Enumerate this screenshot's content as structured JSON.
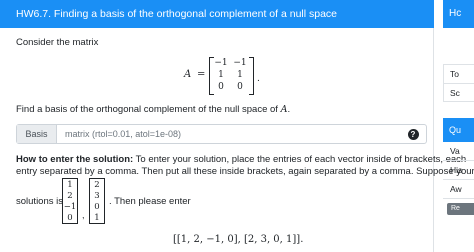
{
  "header": {
    "title": "HW6.7. Finding a basis of the orthogonal complement of a null space"
  },
  "question": {
    "consider": "Consider the matrix",
    "matrix": {
      "label": "A",
      "equals": "=",
      "rows": [
        [
          "−1",
          "−1"
        ],
        [
          "1",
          "1"
        ],
        [
          "0",
          "0"
        ]
      ],
      "period": "."
    },
    "task_prefix": "Find a basis of the orthogonal complement of the null space of ",
    "task_var": "A",
    "task_suffix": "."
  },
  "answer": {
    "addon_label": "Basis",
    "placeholder": "matrix (rtol=0.01, atol=1e-08)",
    "help_symbol": "?"
  },
  "instructions": {
    "heading": "How to enter the solution:",
    "line1_text": " To enter your solution, place the entries of each vector inside of brackets, each",
    "line2_text": "entry separated by a comma. Then put all these inside brackets, again separated by a comma. Suppose your",
    "solutions_is": "solutions is",
    "vector1": [
      "1",
      "2",
      "−1",
      "0"
    ],
    "vector2": [
      "2",
      "3",
      "0",
      "1"
    ],
    "vector_separator": ",",
    "then_enter": ". Then please enter",
    "example": "[[1, 2, −1, 0], [2, 3, 0, 1]]."
  },
  "sidebar": {
    "top_header": "Hc",
    "info_items": [
      "To",
      "Sc"
    ],
    "question_header": "Qu",
    "question_items": [
      "Va",
      "His",
      "Aw"
    ],
    "button_label": "Re"
  },
  "colors": {
    "header_bg": "#1a8ff5",
    "header_text": "#ffffff",
    "addon_bg": "#e9ecef",
    "border": "#ced4da",
    "button_bg": "#6c757d"
  }
}
